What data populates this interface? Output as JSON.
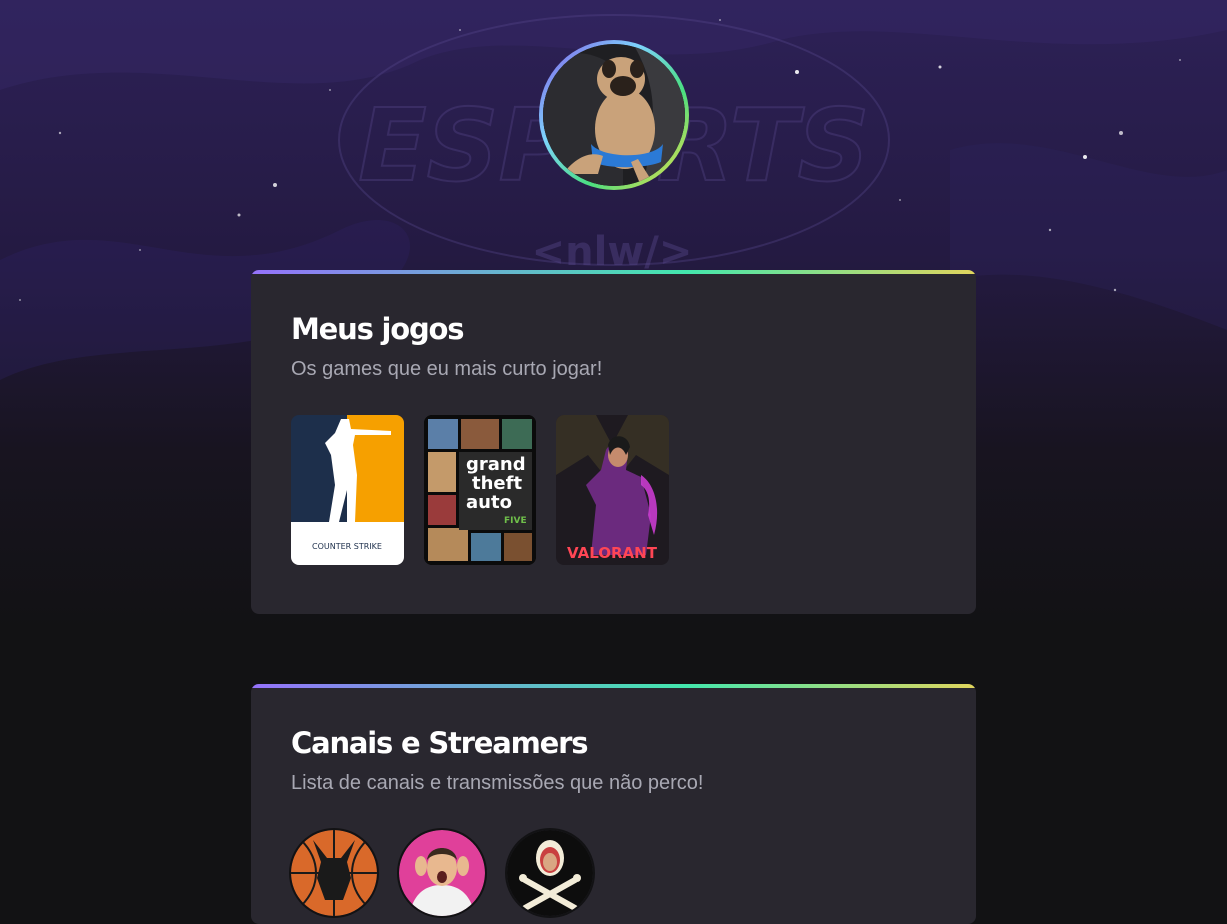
{
  "background": {
    "logo_text": "ESPORTS",
    "tag_text": "<nlw/>"
  },
  "profile": {
    "avatar_name": "pug-avatar",
    "ring_colors": [
      "#8257e6",
      "#7dd3fc",
      "#4ade80",
      "#f7dd43"
    ]
  },
  "games_section": {
    "title": "Meus jogos",
    "subtitle": "Os games que eu mais curto jogar!",
    "games": [
      {
        "name": "Counter-Strike",
        "label": "COUNTER STRIKE"
      },
      {
        "name": "Grand Theft Auto V",
        "label1": "grand",
        "label2": "theft",
        "label3": "auto",
        "label4": "FIVE"
      },
      {
        "name": "Valorant",
        "label": "VALORANT"
      }
    ]
  },
  "channels_section": {
    "title": "Canais e Streamers",
    "subtitle": "Lista de canais e transmissões que não perco!"
  },
  "colors": {
    "page_bg": "#121214",
    "card_bg": "#29272f",
    "title": "#ffffff",
    "subtitle": "#a8a8b3",
    "purple": "#8257e6"
  }
}
